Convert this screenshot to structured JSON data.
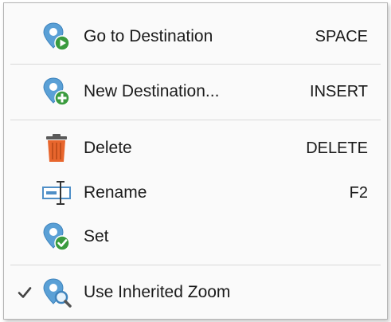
{
  "menu": {
    "items": [
      {
        "label": "Go to Destination",
        "shortcut": "SPACE",
        "icon": "pin-play-icon"
      },
      {
        "label": "New Destination...",
        "shortcut": "INSERT",
        "icon": "pin-add-icon"
      },
      {
        "label": "Delete",
        "shortcut": "DELETE",
        "icon": "trash-icon"
      },
      {
        "label": "Rename",
        "shortcut": "F2",
        "icon": "rename-icon"
      },
      {
        "label": "Set",
        "shortcut": "",
        "icon": "pin-check-icon"
      },
      {
        "label": "Use Inherited Zoom",
        "shortcut": "",
        "icon": "pin-zoom-icon",
        "checked": true
      }
    ]
  },
  "colors": {
    "pin_blue": "#5aa0d6",
    "badge_green": "#3a9b3e",
    "trash_orange": "#e8662d",
    "separator": "#d9d9d9"
  }
}
